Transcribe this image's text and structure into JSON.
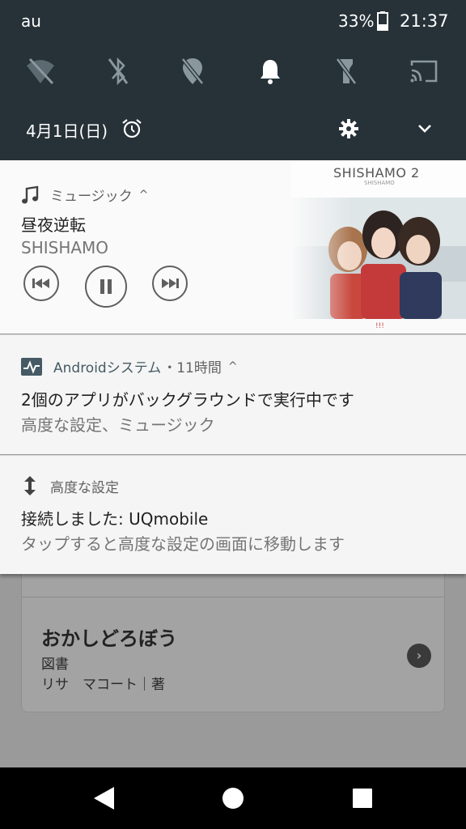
{
  "status_bar": {
    "carrier": "au",
    "battery_pct": "33%",
    "time": "21:37"
  },
  "quick_settings": {
    "tiles": [
      "wifi-off-icon",
      "bluetooth-off-icon",
      "location-off-icon",
      "bell-icon",
      "flashlight-off-icon",
      "cast-icon"
    ]
  },
  "shade_footer": {
    "date": "4月1日(日)"
  },
  "music_notification": {
    "app_name": "ミュージック",
    "caret": "^",
    "song_title": "昼夜逆転",
    "artist": "SHISHAMO",
    "album_art_text": "SHISHAMO 2",
    "album_art_subtext": "SHISHAMO",
    "album_art_mark": "!!!"
  },
  "system_notification": {
    "app_name": "Androidシステム",
    "time_suffix": "・11時間",
    "caret": "^",
    "title": "2個のアプリがバックグラウンドで実行中です",
    "text": "高度な設定、ミュージック"
  },
  "settings_notification": {
    "app_name": "高度な設定",
    "title": "接続しました: UQmobile",
    "text": "タップすると高度な設定の画面に移動します"
  },
  "background_card": {
    "title": "おかしどろぼう",
    "category": "図書",
    "author": "リサ　マコート｜著"
  },
  "nav_bar": {
    "buttons": [
      "back-icon",
      "home-icon",
      "recents-icon"
    ]
  },
  "colors": {
    "shade": "#263238",
    "notification_bg": "#f5f5f5",
    "accent": "#455a64"
  }
}
